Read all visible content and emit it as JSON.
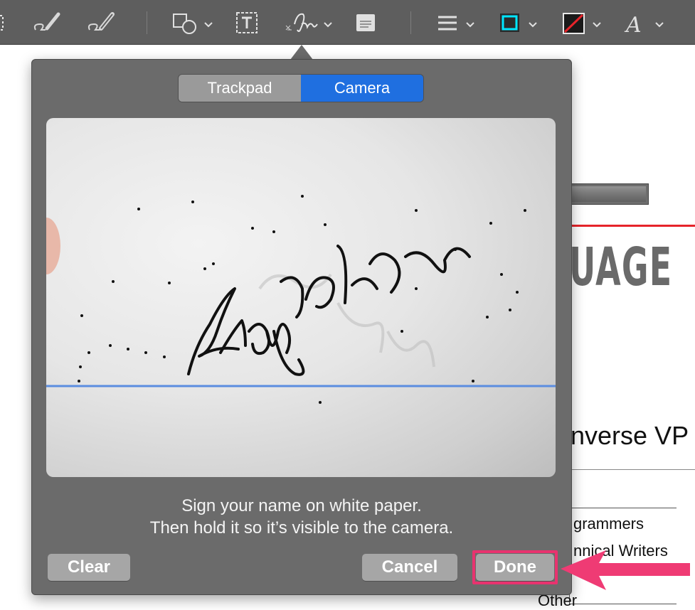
{
  "toolbar": {
    "icons": [
      "selection-icon",
      "sketch-icon",
      "draw-icon",
      "shapes-icon",
      "text-box-icon",
      "signature-icon",
      "note-icon",
      "line-style-icon",
      "border-color-icon",
      "fill-color-icon",
      "text-style-icon"
    ],
    "border_color": "#00e5ff",
    "fill_color": "#e6242a"
  },
  "signature_popover": {
    "tabs": [
      {
        "label": "Trackpad",
        "selected": false
      },
      {
        "label": "Camera",
        "selected": true
      }
    ],
    "instructions_line1": "Sign your name on white paper.",
    "instructions_line2": "Then hold it so it’s visible to the camera.",
    "clear_label": "Clear",
    "cancel_label": "Cancel",
    "done_label": "Done",
    "accent_color": "#1f6fe0",
    "highlight_color": "#e8336f"
  },
  "document": {
    "wordmark": "UAGE",
    "heading": "nverse VP",
    "legend": [
      "grammers",
      "nnical Writers",
      "Other"
    ]
  }
}
